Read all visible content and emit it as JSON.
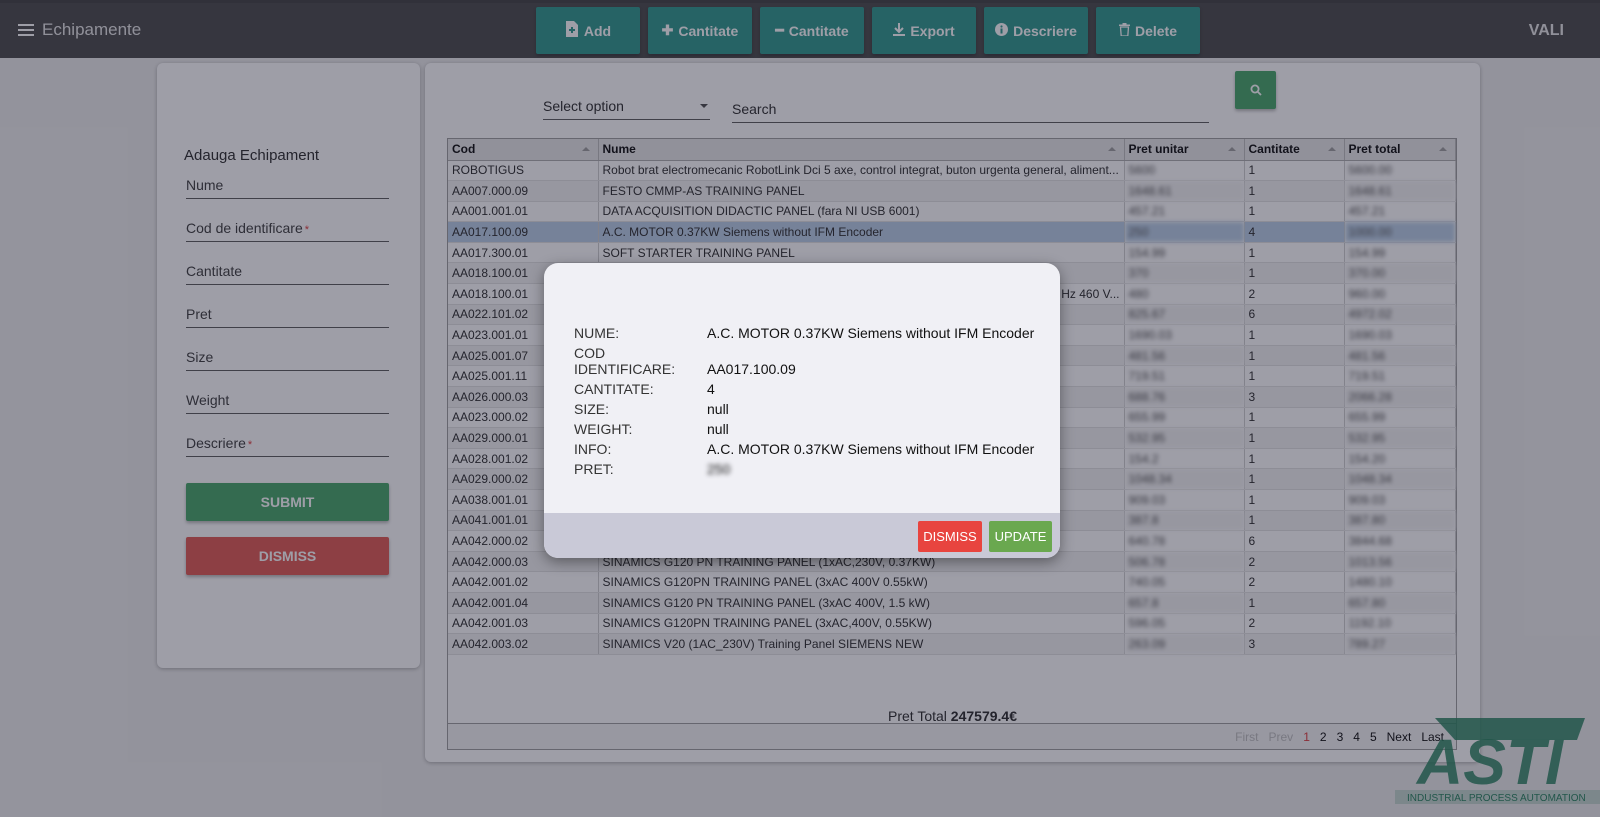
{
  "app": {
    "title": "Echipamente",
    "user": "VALI"
  },
  "toolbar": [
    {
      "label": "Add",
      "icon": "file-add-icon"
    },
    {
      "label": "Cantitate",
      "icon": "plus-icon"
    },
    {
      "label": "Cantitate",
      "icon": "minus-icon"
    },
    {
      "label": "Export",
      "icon": "download-icon"
    },
    {
      "label": "Descriere",
      "icon": "info-icon"
    },
    {
      "label": "Delete",
      "icon": "trash-icon"
    }
  ],
  "form": {
    "title": "Adauga Echipament",
    "fields": [
      {
        "label": "Nume",
        "required": false
      },
      {
        "label": "Cod de identificare",
        "required": true
      },
      {
        "label": "Cantitate",
        "required": false
      },
      {
        "label": "Pret",
        "required": false
      },
      {
        "label": "Size",
        "required": false
      },
      {
        "label": "Weight",
        "required": false
      },
      {
        "label": "Descriere",
        "required": true
      }
    ],
    "submit": "SUBMIT",
    "dismiss": "DISMISS"
  },
  "filters": {
    "select_option": "Select option",
    "search_placeholder": "Search"
  },
  "table": {
    "columns": [
      "Cod",
      "Nume",
      "Pret unitar",
      "Cantitate",
      "Pret total"
    ],
    "rows": [
      [
        "ROBOTIGUS",
        "Robot brat electromecanic RobotLink Dci 5 axe, control integrat, buton urgenta general, aliment...",
        "5600",
        "1",
        "5600.00"
      ],
      [
        "AA007.000.09",
        "FESTO CMMP-AS TRAINING PANEL",
        "1648.61",
        "1",
        "1648.61"
      ],
      [
        "AA001.001.01",
        "DATA ACQUISITION DIDACTIC PANEL (fara NI USB 6001)",
        "457.21",
        "1",
        "457.21"
      ],
      [
        "AA017.100.09",
        "A.C. MOTOR 0.37KW Siemens without IFM Encoder",
        "250",
        "4",
        "1000.00"
      ],
      [
        "AA017.300.01",
        "SOFT STARTER TRAINING PANEL",
        "154.99",
        "1",
        "154.99"
      ],
      [
        "AA018.100.01",
        "",
        "370",
        "1",
        "370.00"
      ],
      [
        "AA018.100.01",
        "Hz 460 V...",
        "480",
        "2",
        "960.00"
      ],
      [
        "AA022.101.02",
        "",
        "825.67",
        "6",
        "4972.02"
      ],
      [
        "AA023.001.01",
        "",
        "1690.03",
        "1",
        "1690.03"
      ],
      [
        "AA025.001.07",
        "",
        "481.56",
        "1",
        "481.56"
      ],
      [
        "AA025.001.11",
        "",
        "719.51",
        "1",
        "719.51"
      ],
      [
        "AA026.000.03",
        "",
        "688.76",
        "3",
        "2066.28"
      ],
      [
        "AA023.000.02",
        "",
        "655.99",
        "1",
        "655.99"
      ],
      [
        "AA029.000.01",
        "",
        "532.95",
        "1",
        "532.95"
      ],
      [
        "AA028.001.02",
        "",
        "154.2",
        "1",
        "154.20"
      ],
      [
        "AA029.000.02",
        "",
        "1048.34",
        "1",
        "1048.34"
      ],
      [
        "AA038.001.01",
        "",
        "909.03",
        "1",
        "909.03"
      ],
      [
        "AA041.001.01",
        "",
        "387.8",
        "1",
        "387.80"
      ],
      [
        "AA042.000.02",
        "",
        "640.78",
        "6",
        "3844.68"
      ],
      [
        "AA042.000.03",
        "SINAMICS G120 PN TRAINING PANEL (1xAC,230V, 0.37KW)",
        "506.78",
        "2",
        "1013.56"
      ],
      [
        "AA042.001.02",
        "SINAMICS G120PN TRAINING PANEL (3xAC 400V 0.55kW)",
        "740.05",
        "2",
        "1480.10"
      ],
      [
        "AA042.001.04",
        "SINAMICS G120 PN TRAINING PANEL (3xAC 400V, 1.5 kW)",
        "657.8",
        "1",
        "657.80"
      ],
      [
        "AA042.001.03",
        "SINAMICS G120PN TRAINING PANEL (3xAC,400V, 0.55KW)",
        "596.05",
        "2",
        "1192.10"
      ],
      [
        "AA042.003.02",
        "SINAMICS V20 (1AC_230V) Training Panel SIEMENS NEW",
        "263.09",
        "3",
        "789.27"
      ]
    ],
    "selected_index": 3
  },
  "pager": {
    "first": "First",
    "prev": "Prev",
    "pages": [
      "1",
      "2",
      "3",
      "4",
      "5"
    ],
    "current": "1",
    "next": "Next",
    "last": "Last"
  },
  "total": {
    "label": "Pret Total",
    "value": "247579.4€"
  },
  "modal": {
    "rows": [
      {
        "label": "NUME:",
        "value": "A.C. MOTOR 0.37KW Siemens without IFM Encoder"
      },
      {
        "label": "COD IDENTIFICARE:",
        "value": "AA017.100.09"
      },
      {
        "label": "CANTITATE:",
        "value": "4"
      },
      {
        "label": "SIZE:",
        "value": "null"
      },
      {
        "label": "WEIGHT:",
        "value": "null"
      },
      {
        "label": "INFO:",
        "value": "A.C. MOTOR 0.37KW Siemens without IFM Encoder"
      },
      {
        "label": "PRET:",
        "value": "250"
      }
    ],
    "dismiss": "DISMISS",
    "update": "UPDATE"
  },
  "logo": {
    "text": "ASTI",
    "tagline": "INDUSTRIAL PROCESS AUTOMATION",
    "color": "#1e7d57"
  },
  "colors": {
    "accent": "#269487",
    "success": "#3fa361",
    "danger": "#e0524b"
  }
}
